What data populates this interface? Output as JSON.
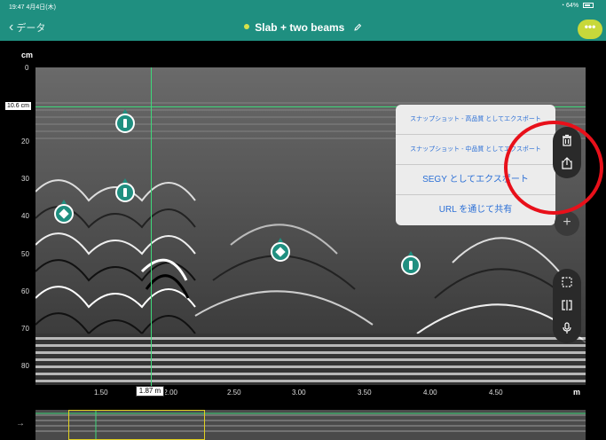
{
  "status": {
    "time": "19:47",
    "date": "4月4日(木)",
    "battery": "64%"
  },
  "header": {
    "back_label": "データ",
    "title": "Slab + two beams"
  },
  "depth_axis": {
    "unit": "cm",
    "ticks": [
      "0",
      "20",
      "30",
      "40",
      "50",
      "60",
      "70",
      "80"
    ]
  },
  "distance_axis": {
    "unit": "m",
    "ticks": [
      "1.50",
      "2.00",
      "2.50",
      "3.00",
      "3.50",
      "4.00",
      "4.50"
    ]
  },
  "cursor": {
    "depth_label": "10.6 cm",
    "position_label": "1.87 m"
  },
  "export_menu": {
    "items": [
      {
        "label": "スナップショット - 高品質 としてエクスポート"
      },
      {
        "label": "スナップショット - 中品質 としてエクスポート"
      },
      {
        "label": "SEGY としてエクスポート"
      },
      {
        "label": "URL を通じて共有"
      }
    ]
  },
  "tools": {
    "add": "+"
  },
  "colors": {
    "accent": "#1f8f80",
    "grid_line": "#3ed87a",
    "menu_text": "#2b6fd6",
    "highlight": "#e8101a",
    "more_button": "#c8d83a"
  }
}
